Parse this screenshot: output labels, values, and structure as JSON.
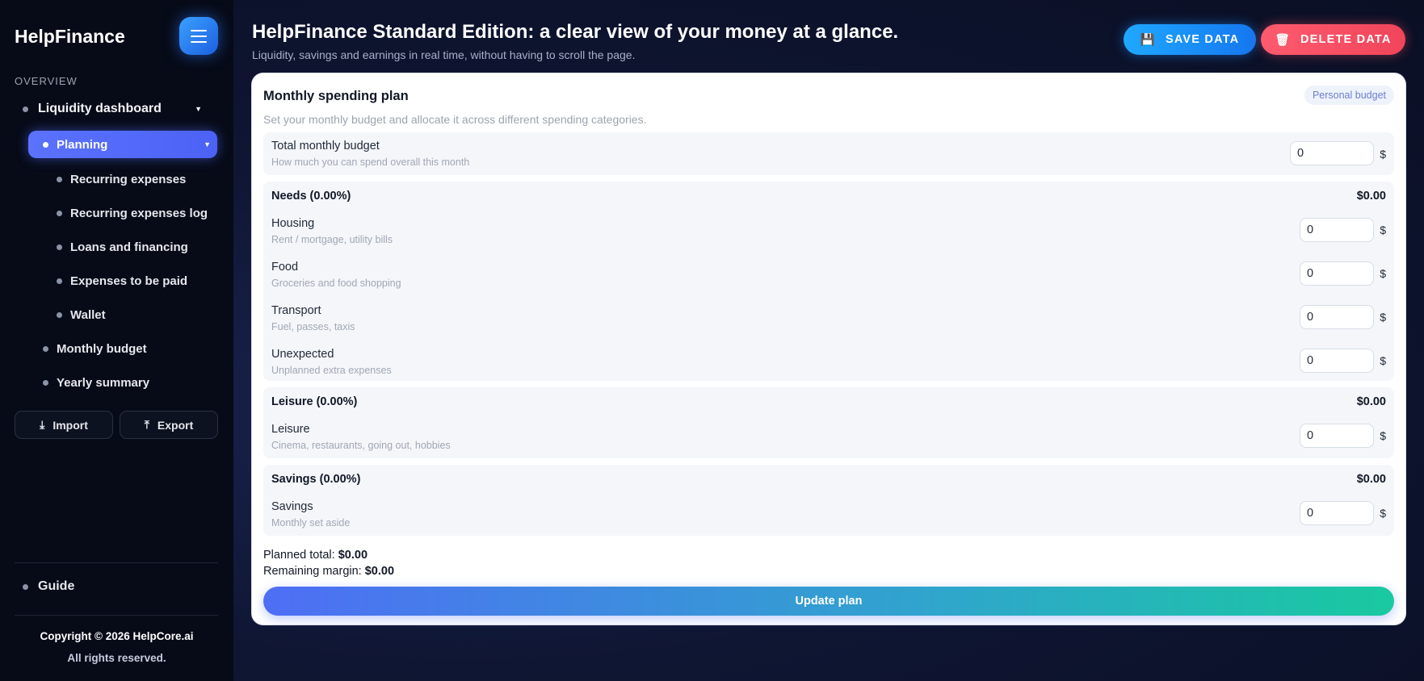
{
  "sidebar": {
    "brand": "HelpFinance",
    "section_label": "OVERVIEW",
    "liquidity": "Liquidity dashboard",
    "planning": "Planning",
    "sub_items": [
      "Recurring expenses",
      "Recurring expenses log",
      "Loans and financing",
      "Expenses to be paid",
      "Wallet"
    ],
    "mid_items": [
      "Monthly budget",
      "Yearly summary"
    ],
    "import_label": "Import",
    "export_label": "Export",
    "guide": "Guide",
    "copyright": "Copyright © 2026 HelpCore.ai",
    "rights": "All rights reserved."
  },
  "header": {
    "title": "HelpFinance Standard Edition: a clear view of your money at a glance.",
    "subtitle": "Liquidity, savings and earnings in real time, without having to scroll the page.",
    "save_label": "SAVE DATA",
    "delete_label": "DELETE DATA"
  },
  "card": {
    "title": "Monthly spending plan",
    "badge": "Personal budget",
    "description": "Set your monthly budget and allocate it across different spending categories.",
    "total_budget": {
      "label": "Total monthly budget",
      "hint": "How much you can spend overall this month",
      "value": "0",
      "currency": "$"
    },
    "needs": {
      "title": "Needs (0.00%)",
      "amount": "$0.00",
      "rows": [
        {
          "label": "Housing",
          "hint": "Rent / mortgage, utility bills",
          "value": "0",
          "currency": "$"
        },
        {
          "label": "Food",
          "hint": "Groceries and food shopping",
          "value": "0",
          "currency": "$"
        },
        {
          "label": "Transport",
          "hint": "Fuel, passes, taxis",
          "value": "0",
          "currency": "$"
        },
        {
          "label": "Unexpected",
          "hint": "Unplanned extra expenses",
          "value": "0",
          "currency": "$"
        }
      ]
    },
    "leisure": {
      "title": "Leisure (0.00%)",
      "amount": "$0.00",
      "rows": [
        {
          "label": "Leisure",
          "hint": "Cinema, restaurants, going out, hobbies",
          "value": "0",
          "currency": "$"
        }
      ]
    },
    "savings": {
      "title": "Savings (0.00%)",
      "amount": "$0.00",
      "rows": [
        {
          "label": "Savings",
          "hint": "Monthly set aside",
          "value": "0",
          "currency": "$"
        }
      ]
    },
    "planned_total_label": "Planned total:",
    "planned_total_value": "$0.00",
    "remaining_label": "Remaining margin:",
    "remaining_value": "$0.00",
    "update_label": "Update plan"
  }
}
